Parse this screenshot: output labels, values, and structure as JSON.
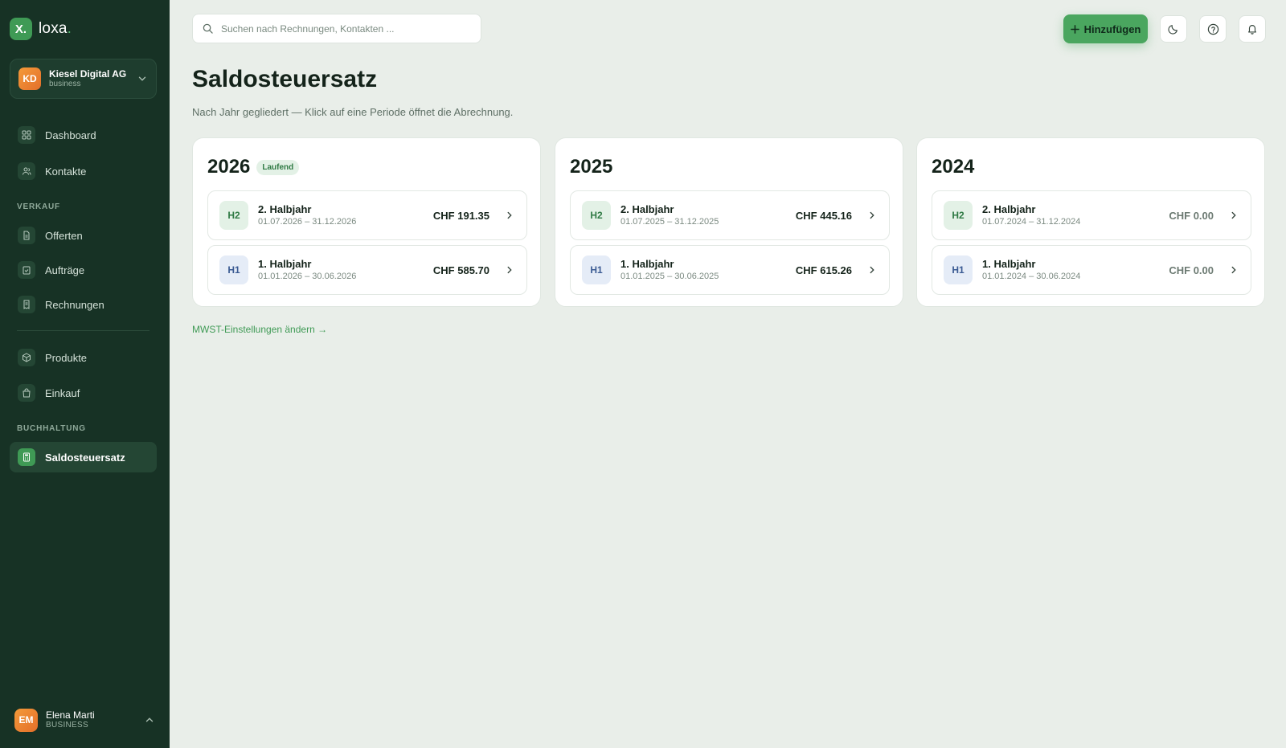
{
  "brand": {
    "mark": "X.",
    "name": "loxa",
    "dot": "."
  },
  "org": {
    "initials": "KD",
    "name": "Kiesel Digital AG",
    "plan": "business"
  },
  "nav": {
    "dashboard": "Dashboard",
    "kontakte": "Kontakte",
    "section_verkauf": "VERKAUF",
    "offerten": "Offerten",
    "auftraege": "Aufträge",
    "rechnungen": "Rechnungen",
    "produkte": "Produkte",
    "einkauf": "Einkauf",
    "section_buchhaltung": "BUCHHALTUNG",
    "saldosteuersatz": "Saldosteuersatz"
  },
  "user": {
    "initials": "EM",
    "name": "Elena Marti",
    "role": "BUSINESS"
  },
  "topbar": {
    "search_placeholder": "Suchen nach Rechnungen, Kontakten ...",
    "add_label": "Hinzufügen"
  },
  "page": {
    "title": "Saldosteuersatz",
    "subtitle": "Nach Jahr gegliedert — Klick auf eine Periode öffnet die Abrechnung.",
    "mwst_link": "MWST-Einstellungen ändern →"
  },
  "years": [
    {
      "year": "2026",
      "badge": "Laufend",
      "periods": [
        {
          "tag": "H2",
          "name": "2. Halbjahr",
          "range": "01.07.2026 – 31.12.2026",
          "amount": "CHF 191.35"
        },
        {
          "tag": "H1",
          "name": "1. Halbjahr",
          "range": "01.01.2026 – 30.06.2026",
          "amount": "CHF 585.70"
        }
      ]
    },
    {
      "year": "2025",
      "badge": "",
      "periods": [
        {
          "tag": "H2",
          "name": "2. Halbjahr",
          "range": "01.07.2025 – 31.12.2025",
          "amount": "CHF 445.16"
        },
        {
          "tag": "H1",
          "name": "1. Halbjahr",
          "range": "01.01.2025 – 30.06.2025",
          "amount": "CHF 615.26"
        }
      ]
    },
    {
      "year": "2024",
      "badge": "",
      "periods": [
        {
          "tag": "H2",
          "name": "2. Halbjahr",
          "range": "01.07.2024 – 31.12.2024",
          "amount": "CHF 0.00"
        },
        {
          "tag": "H1",
          "name": "1. Halbjahr",
          "range": "01.01.2024 – 30.06.2024",
          "amount": "CHF 0.00"
        }
      ]
    }
  ],
  "colors": {
    "sidebar_bg": "#173225",
    "accent": "#4aa65f",
    "page_bg": "#e9eee9",
    "h2_tag": "#e3f1e6",
    "h1_tag": "#e5ecf7"
  }
}
